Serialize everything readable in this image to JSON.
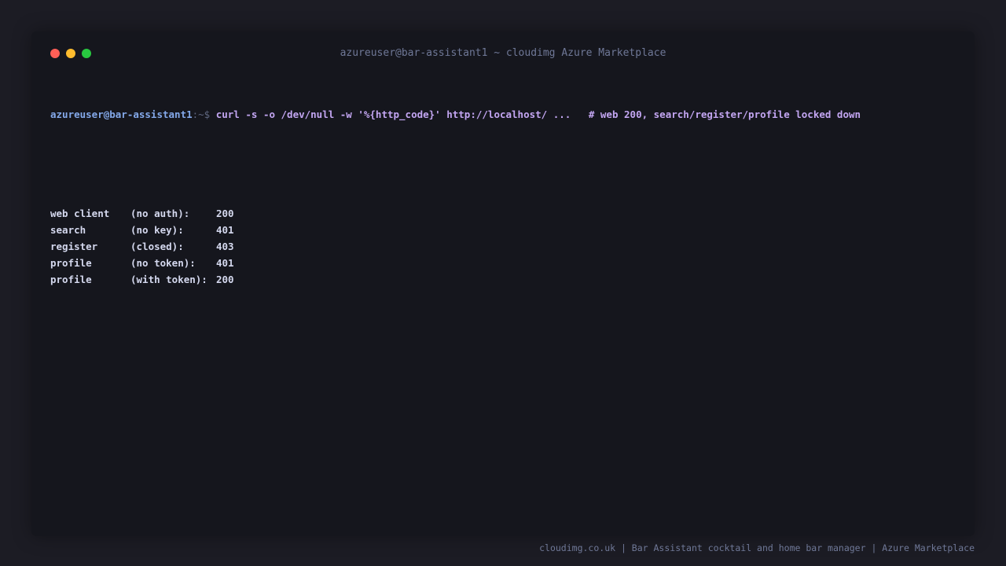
{
  "window": {
    "title": "azureuser@bar-assistant1 ~ cloudimg Azure Marketplace"
  },
  "prompt": {
    "user_host": "azureuser@bar-assistant1",
    "path_symbol": ":~$",
    "command": "curl -s -o /dev/null -w '%{http_code}' http://localhost/ ...",
    "comment": "# web 200, search/register/profile locked down"
  },
  "results": [
    {
      "name": "web client",
      "note": "(no auth):",
      "code": "200"
    },
    {
      "name": "search",
      "note": "(no key):",
      "code": "401"
    },
    {
      "name": "register",
      "note": "(closed):",
      "code": "403"
    },
    {
      "name": "profile",
      "note": "(no token):",
      "code": "401"
    },
    {
      "name": "profile",
      "note": "(with token):",
      "code": "200"
    }
  ],
  "footer": {
    "text": "cloudimg.co.uk | Bar Assistant cocktail and home bar manager | Azure Marketplace"
  },
  "colors": {
    "background": "#1c1c24",
    "window": "#15161d",
    "prompt_user": "#84a9ea",
    "command": "#c3a6f2",
    "output": "#d4d8ee",
    "dot_red": "#ff5f57",
    "dot_yellow": "#febc2e",
    "dot_green": "#28c840"
  }
}
